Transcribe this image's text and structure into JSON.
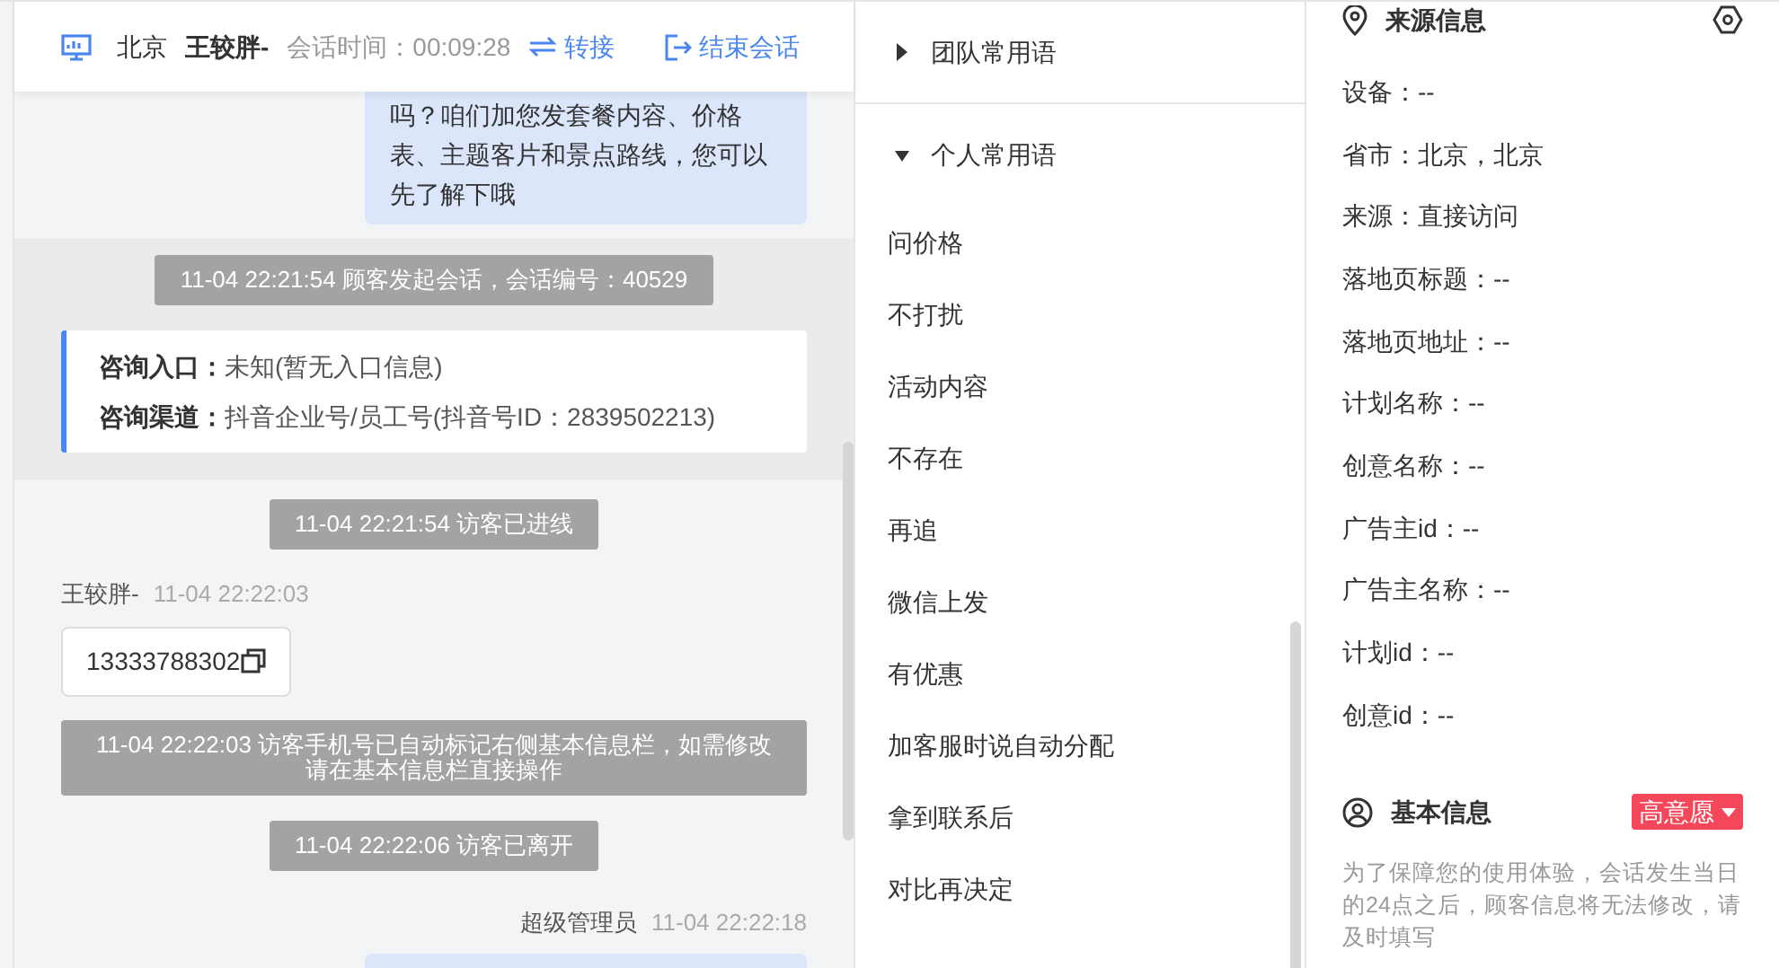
{
  "header": {
    "city": "北京",
    "visitor": "王较胖-",
    "session_time_label": "会话时间：",
    "session_time": "00:09:28",
    "transfer": "转接",
    "end_session": "结束会话"
  },
  "chat": {
    "earlier": [
      {
        "kind": "outgoing",
        "text": "吗？咱们加您发套餐内容、价格表、主题客片和景点路线，您可以先了解下哦"
      }
    ],
    "session_start": [
      {
        "kind": "system",
        "text": "11-04 22:21:54 顾客发起会话，会话编号：40529"
      },
      {
        "kind": "info",
        "rows": [
          {
            "label": "咨询入口：",
            "value": "未知(暂无入口信息)"
          },
          {
            "label": "咨询渠道：",
            "value": "抖音企业号/员工号(抖音号ID：2839502213)"
          }
        ]
      }
    ],
    "messages": [
      {
        "kind": "system",
        "text": "11-04 22:21:54 访客已进线"
      },
      {
        "kind": "incoming",
        "sender": "王较胖-",
        "time": "11-04 22:22:03",
        "text": "13333788302"
      },
      {
        "kind": "system",
        "text": "11-04 22:22:03 访客手机号已自动标记右侧基本信息栏，如需修改请在基本信息栏直接操作"
      },
      {
        "kind": "system",
        "text": "11-04 22:22:06 访客已离开"
      },
      {
        "kind": "outgoing_header",
        "sender": "超级管理员",
        "time": "11-04 22:22:18"
      }
    ]
  },
  "phrases": {
    "groups": [
      {
        "title": "团队常用语",
        "expanded": false
      },
      {
        "title": "个人常用语",
        "expanded": true
      }
    ],
    "items": [
      "问价格",
      "不打扰",
      "活动内容",
      "不存在",
      "再追",
      "微信上发",
      "有优惠",
      "加客服时说自动分配",
      "拿到联系后",
      "对比再决定"
    ]
  },
  "source_info": {
    "title": "来源信息",
    "fields": [
      "设备：--",
      "省市：北京，北京",
      "来源：直接访问",
      "落地页标题：--",
      "落地页地址：--",
      "计划名称：--",
      "创意名称：--",
      "广告主id：--",
      "广告主名称：--",
      "计划id：--",
      "创意id：--"
    ]
  },
  "basic_info": {
    "title": "基本信息",
    "intent": "高意愿",
    "notice": "为了保障您的使用体验，会话发生当日的24点之后，顾客信息将无法修改，请及时填写"
  }
}
